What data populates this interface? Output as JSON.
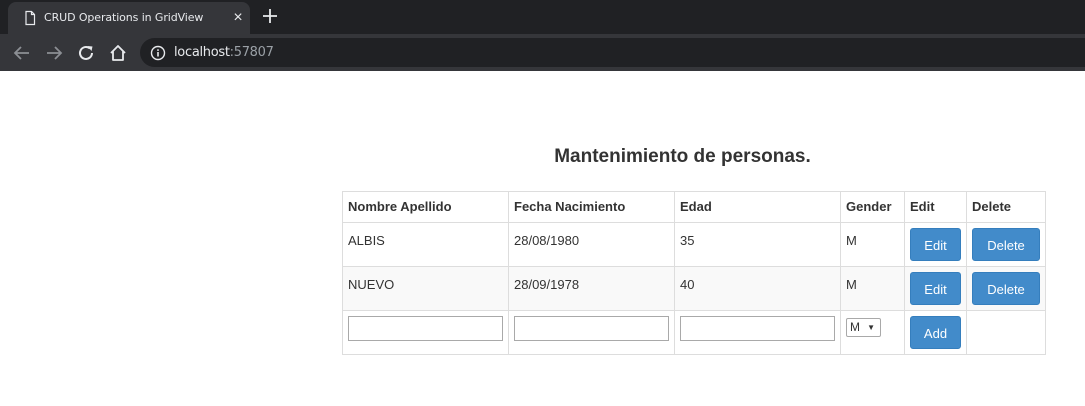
{
  "browser": {
    "tab_title": "CRUD Operations in GridView",
    "url_host": "localhost",
    "url_port": ":57807"
  },
  "page": {
    "heading": "Mantenimiento de personas."
  },
  "grid": {
    "headers": [
      "Nombre Apellido",
      "Fecha Nacimiento",
      "Edad",
      "Gender",
      "Edit",
      "Delete"
    ],
    "rows": [
      {
        "name": "ALBIS",
        "birth": "28/08/1980",
        "age": "35",
        "gender": "M",
        "edit": "Edit",
        "delete": "Delete"
      },
      {
        "name": "NUEVO",
        "birth": "28/09/1978",
        "age": "40",
        "gender": "M",
        "edit": "Edit",
        "delete": "Delete"
      }
    ],
    "insert": {
      "gender_selected": "M",
      "add_label": "Add"
    }
  },
  "colors": {
    "button": "#428bca",
    "chrome_dark": "#202124",
    "chrome_tab": "#35363a"
  }
}
